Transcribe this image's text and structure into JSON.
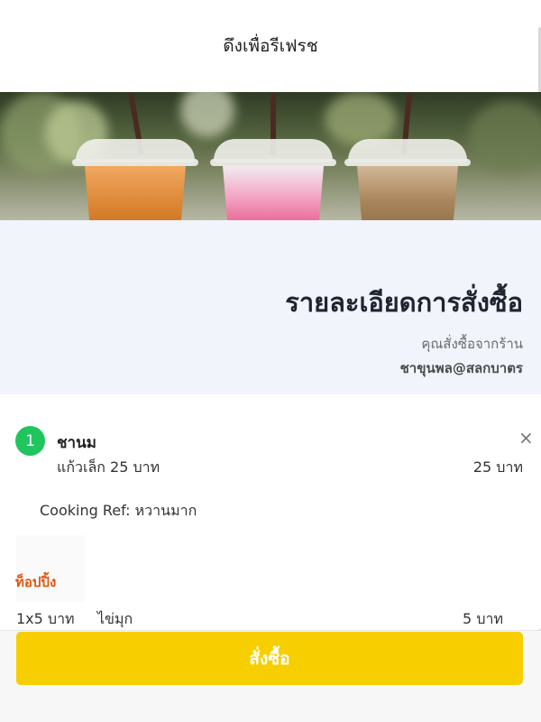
{
  "pull_header": {
    "text": "ดึงเพื่อรีเฟรช"
  },
  "banner": {
    "description_icon": "bubble-tea-banner-image"
  },
  "order": {
    "title": "รายละเอียดการสั่งซื้อ",
    "from_label": "คุณสั่งซื้อจากร้าน",
    "shop_name": "ชาขุนพล@สลกบาตร"
  },
  "item": {
    "quantity": "1",
    "name": "ชานม",
    "size": "แก้วเล็ก",
    "size_price": "25 บาท",
    "line_price": "25 บาท",
    "remove_icon": "close-icon",
    "cooking_ref": "Cooking Ref: หวานมาก",
    "topping_section_label": "ท็อปปิ้ง",
    "toppings": [
      {
        "qty_price": "1x5 บาท",
        "name": "ไข่มุก",
        "price": "5 บาท"
      }
    ]
  },
  "actions": {
    "order_button": "สั่งซื้อ"
  },
  "colors": {
    "accent_yellow": "#f7ce00",
    "badge_green": "#21c55d",
    "topping_orange": "#e0560f",
    "header_bg": "#f1f4fb"
  }
}
